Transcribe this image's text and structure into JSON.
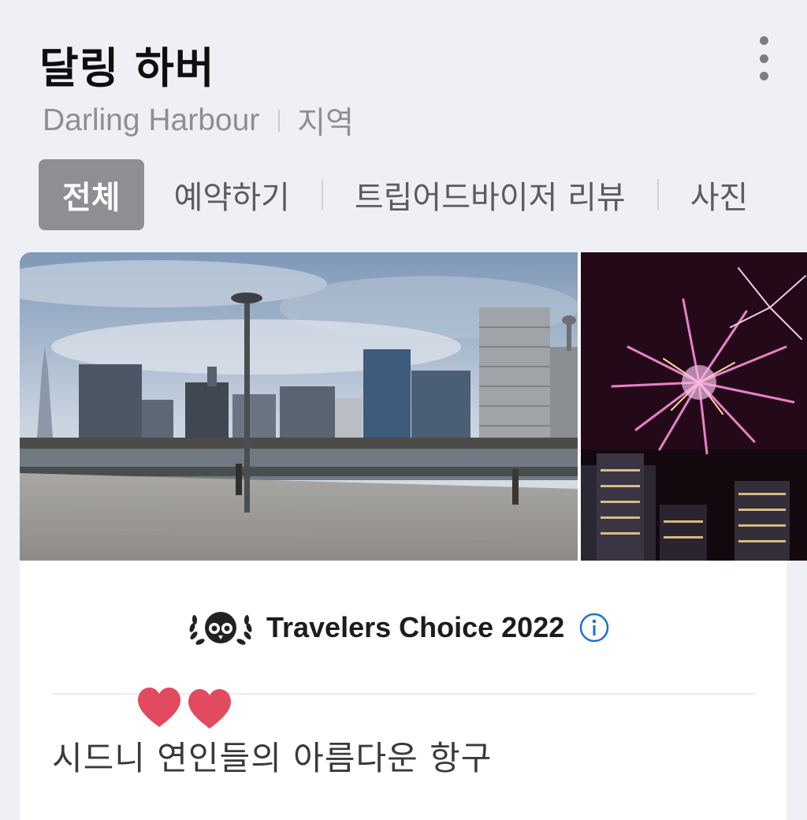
{
  "header": {
    "title": "달링 하버",
    "subtitle_english": "Darling Harbour",
    "subtitle_category": "지역",
    "more_icon": "more-vertical-icon"
  },
  "tabs": [
    {
      "label": "전체",
      "active": true
    },
    {
      "label": "예약하기",
      "active": false
    },
    {
      "label": "트립어드바이저 리뷰",
      "active": false
    },
    {
      "label": "사진",
      "active": false
    }
  ],
  "gallery": {
    "images": [
      {
        "name": "harbour-skyline-photo"
      },
      {
        "name": "fireworks-photo"
      }
    ]
  },
  "award": {
    "icon": "tripadvisor-owl-laurel-icon",
    "text": "Travelers Choice 2022",
    "info_icon": "info-icon",
    "accent_color": "#1a73c9"
  },
  "decoration": {
    "icon": "two-hearts-icon",
    "color": "#e24a5f"
  },
  "description": "시드니 연인들의 아름다운 항구"
}
